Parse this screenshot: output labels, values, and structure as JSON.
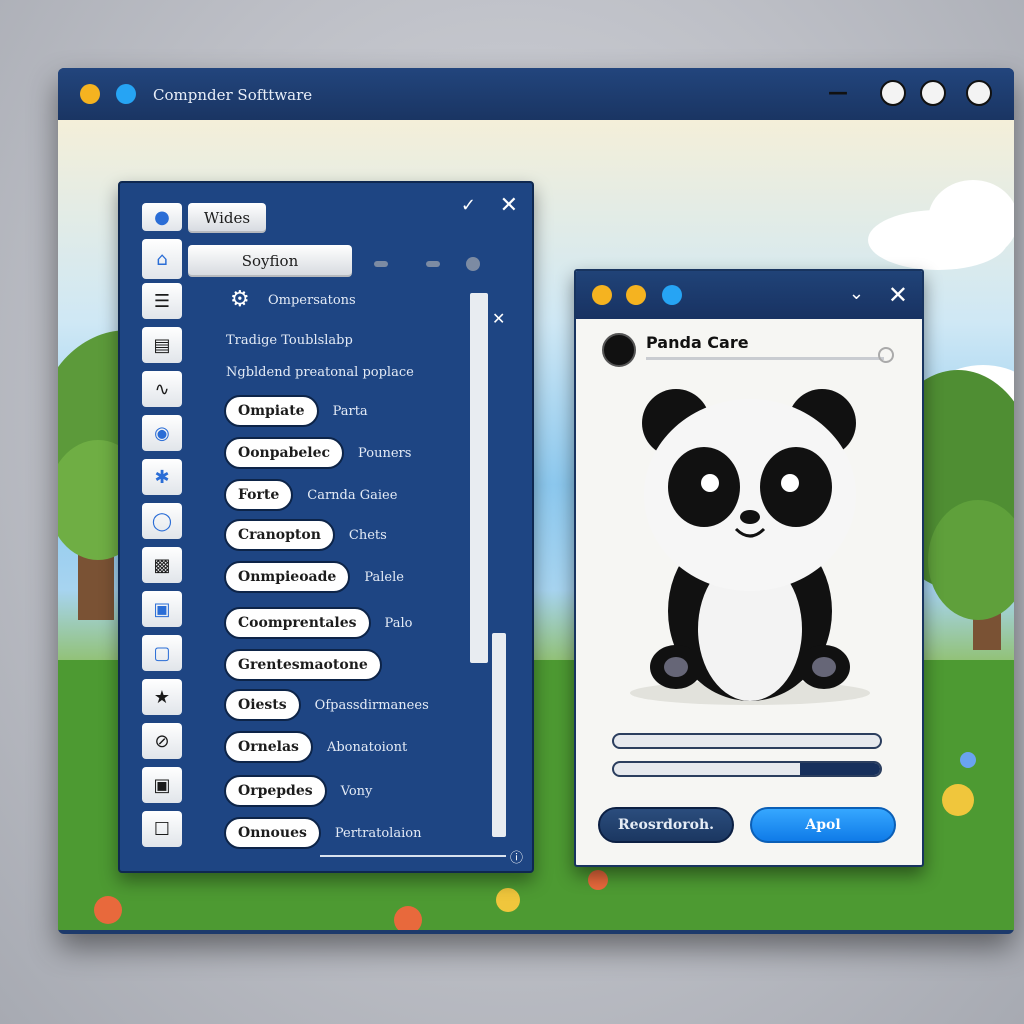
{
  "window": {
    "title": "Compnder Softtware"
  },
  "left_panel": {
    "tabs": [
      {
        "label": "Wides"
      },
      {
        "label": "Soyfion"
      }
    ],
    "header_item": "Ompersatons",
    "text_lines": [
      "Tradige Toublslabp",
      "Ngbldend preatonal poplace"
    ],
    "rows": [
      {
        "button": "Ompiate",
        "label": "Parta"
      },
      {
        "button": "Oonpabelec",
        "label": "Pouners"
      },
      {
        "button": "Forte",
        "label": "Carnda Gaiee"
      },
      {
        "button": "Cranopton",
        "label": "Chets"
      },
      {
        "button": "Onmpieoade",
        "label": "Palele"
      },
      {
        "button": "Coomprentales",
        "label": "Palo"
      },
      {
        "button": "Grentesmaotone",
        "label": ""
      },
      {
        "button": "Oiests",
        "label": "Ofpassdirmanees"
      },
      {
        "button": "Ornelas",
        "label": "Abonatoiont"
      },
      {
        "button": "Orpepdes",
        "label": "Vony"
      },
      {
        "button": "Onnoues",
        "label": "Pertratolaion"
      }
    ],
    "side_icons": [
      "chat-bubble-icon",
      "home-icon",
      "list-icon",
      "document-icon",
      "chart-icon",
      "globe-icon",
      "network-icon",
      "shield-icon",
      "grid-icon",
      "image-icon",
      "tag-icon",
      "star-icon",
      "block-icon",
      "photo-icon",
      "lock-icon"
    ]
  },
  "dialog": {
    "heading": "Panda Care",
    "progress_1": 0,
    "progress_2": 0.3,
    "secondary_button": "Reosrdoroh.",
    "primary_button": "Apol"
  },
  "colors": {
    "window_chrome": "#1d3a6b",
    "panel_blue": "#1e4583",
    "accent_blue": "#1a8cf5",
    "dot_yellow": "#f5b320",
    "dot_blue": "#26a4f4"
  }
}
